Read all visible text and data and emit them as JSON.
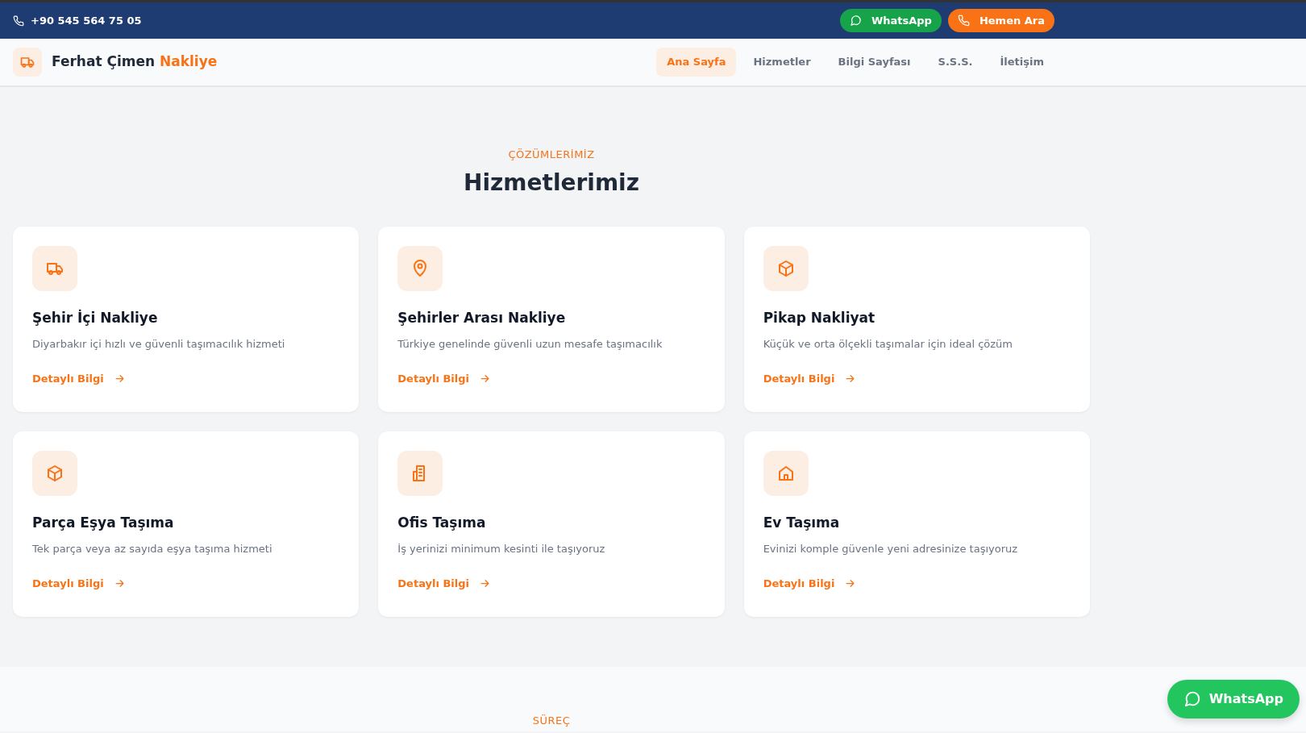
{
  "topbar": {
    "phone": "+90 545 564 75 05",
    "buttons": [
      {
        "kind": "whatsapp",
        "label": "WhatsApp"
      },
      {
        "kind": "call",
        "label": "Hemen Ara"
      }
    ]
  },
  "navbar": {
    "brand": {
      "name": "Ferhat Çimen",
      "accent": "Nakliye"
    },
    "links": [
      {
        "label": "Ana Sayfa",
        "selected": true
      },
      {
        "label": "Hizmetler",
        "selected": false
      },
      {
        "label": "Bilgi Sayfası",
        "selected": false
      },
      {
        "label": "S.S.S.",
        "selected": false
      },
      {
        "label": "İletişim",
        "selected": false
      }
    ]
  },
  "services": {
    "eyebrow": "ÇÖZÜMLERİMİZ",
    "title": "Hizmetlerimiz",
    "cards": [
      {
        "kind": "truck",
        "title": "Şehir İçi Nakliye",
        "text": "Diyarbakır içi hızlı ve güvenli taşımacılık hizmeti",
        "link": "Detaylı Bilgi"
      },
      {
        "kind": "pin",
        "title": "Şehirler Arası Nakliye",
        "text": "Türkiye genelinde güvenli uzun mesafe taşımacılık",
        "link": "Detaylı Bilgi"
      },
      {
        "kind": "box",
        "title": "Pikap Nakliyat",
        "text": "Küçük ve orta ölçekli taşımalar için ideal çözüm",
        "link": "Detaylı Bilgi"
      },
      {
        "kind": "box",
        "title": "Parça Eşya Taşıma",
        "text": "Tek parça veya az sayıda eşya taşıma hizmeti",
        "link": "Detaylı Bilgi"
      },
      {
        "kind": "building",
        "title": "Ofis Taşıma",
        "text": "İş yerinizi minimum kesinti ile taşıyoruz",
        "link": "Detaylı Bilgi"
      },
      {
        "kind": "house",
        "title": "Ev Taşıma",
        "text": "Evinizi komple güvenle yeni adresinize taşıyoruz",
        "link": "Detaylı Bilgi"
      }
    ]
  },
  "process": {
    "eyebrow": "SÜREÇ"
  },
  "floating_button": {
    "label": "WhatsApp"
  }
}
